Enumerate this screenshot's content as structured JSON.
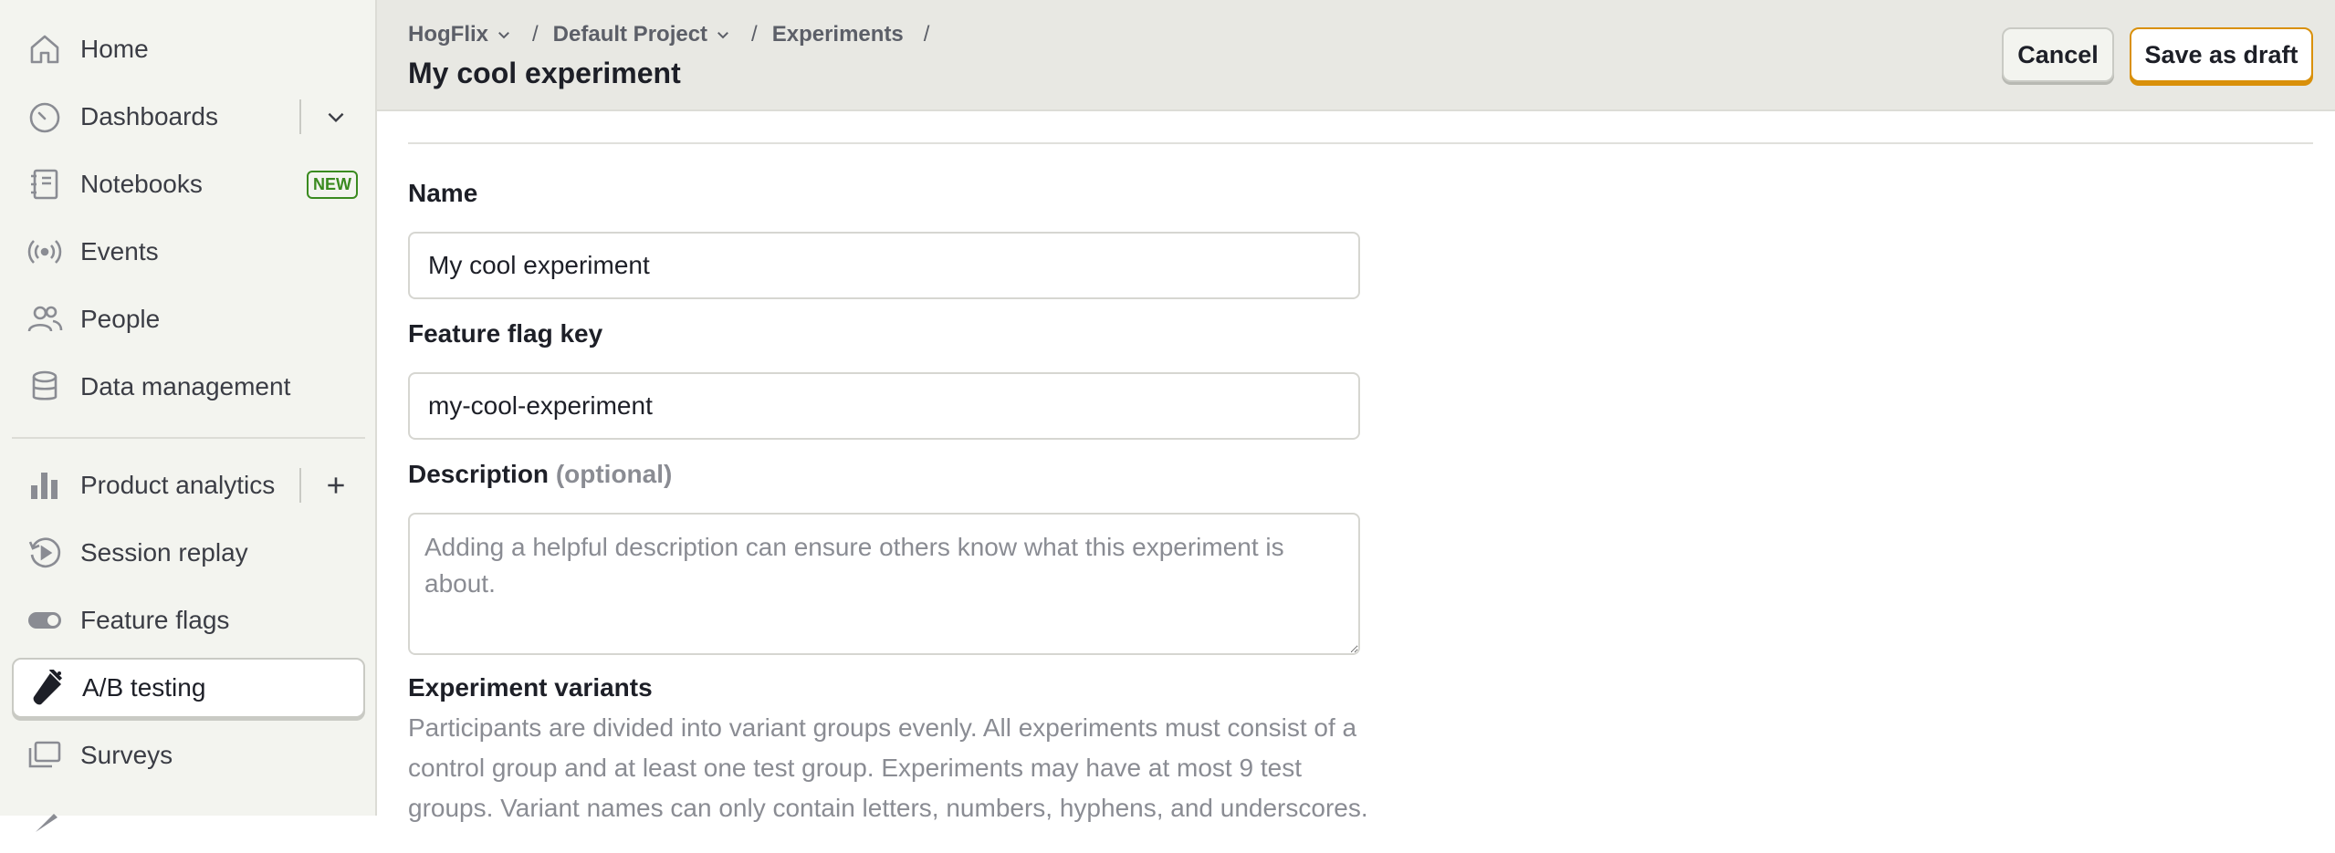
{
  "sidebar": {
    "items": [
      {
        "label": "Home",
        "icon": "home-icon"
      },
      {
        "label": "Dashboards",
        "icon": "dashboard-gauge-icon"
      },
      {
        "label": "Notebooks",
        "icon": "notebook-icon",
        "badge": "NEW"
      },
      {
        "label": "Events",
        "icon": "broadcast-icon"
      },
      {
        "label": "People",
        "icon": "people-icon"
      },
      {
        "label": "Data management",
        "icon": "database-icon"
      },
      {
        "label": "Product analytics",
        "icon": "bar-chart-icon"
      },
      {
        "label": "Session replay",
        "icon": "replay-icon"
      },
      {
        "label": "Feature flags",
        "icon": "toggle-icon"
      },
      {
        "label": "A/B testing",
        "icon": "flask-icon",
        "active": true
      },
      {
        "label": "Surveys",
        "icon": "survey-icon"
      }
    ]
  },
  "header": {
    "breadcrumb": [
      "HogFlix",
      "Default Project",
      "Experiments"
    ],
    "title": "My cool experiment",
    "cancel_label": "Cancel",
    "save_draft_label": "Save as draft"
  },
  "form": {
    "name_label": "Name",
    "name_value": "My cool experiment",
    "flag_key_label": "Feature flag key",
    "flag_key_value": "my-cool-experiment",
    "description_label": "Description",
    "description_optional": "(optional)",
    "description_placeholder": "Adding a helpful description can ensure others know what this experiment is about.",
    "variants_label": "Experiment variants",
    "variants_help": "Participants are divided into variant groups evenly. All experiments must consist of a control group and at least one test group. Experiments may have at most 9 test groups. Variant names can only contain letters, numbers, hyphens, and underscores."
  },
  "colors": {
    "accent": "#d9900a",
    "new_badge": "#3a8a1f",
    "sidebar_bg": "#f3f4ef",
    "topbar_bg": "#e8e8e3"
  }
}
